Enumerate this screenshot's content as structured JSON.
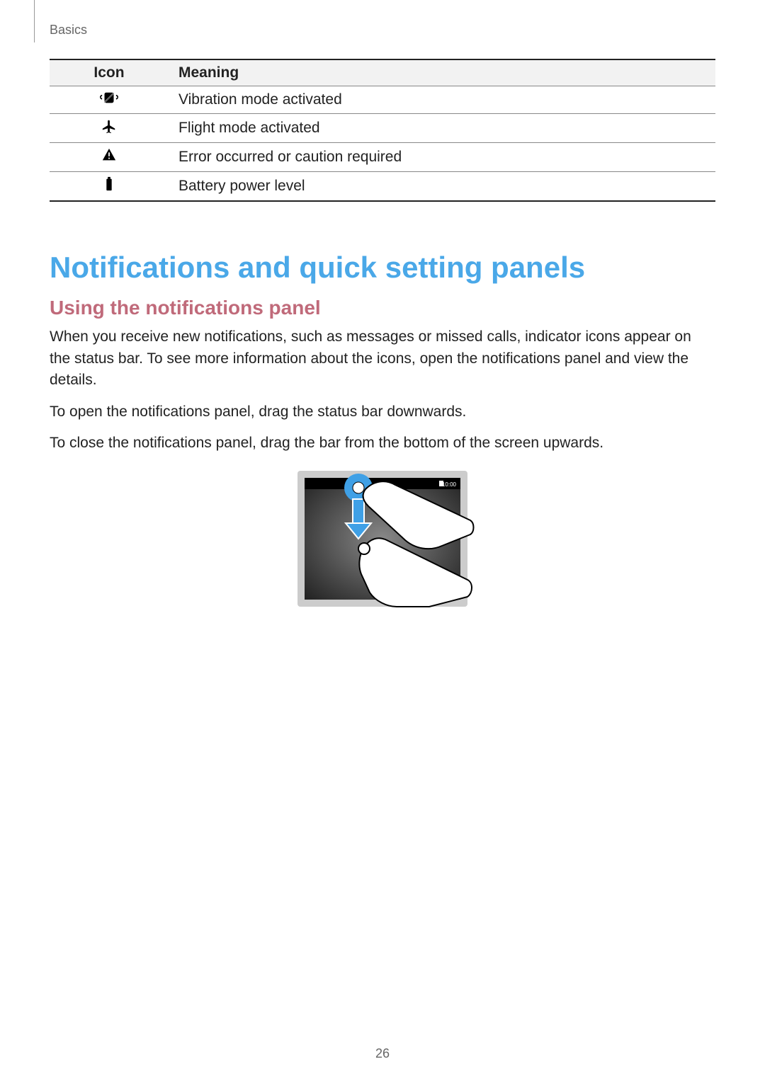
{
  "running_head": "Basics",
  "table": {
    "headers": {
      "icon": "Icon",
      "meaning": "Meaning"
    },
    "rows": [
      {
        "icon_name": "vibration-mode-icon",
        "meaning": "Vibration mode activated"
      },
      {
        "icon_name": "flight-mode-icon",
        "meaning": "Flight mode activated"
      },
      {
        "icon_name": "caution-icon",
        "meaning": "Error occurred or caution required"
      },
      {
        "icon_name": "battery-level-icon",
        "meaning": "Battery power level"
      }
    ]
  },
  "section_heading": "Notifications and quick setting panels",
  "sub_heading": "Using the notifications panel",
  "paragraphs": [
    "When you receive new notifications, such as messages or missed calls, indicator icons appear on the status bar. To see more information about the icons, open the notifications panel and view the details.",
    "To open the notifications panel, drag the status bar downwards.",
    "To close the notifications panel, drag the bar from the bottom of the screen upwards."
  ],
  "illustration": {
    "name": "drag-status-bar-down-illustration",
    "status_time": "10:00"
  },
  "page_number": "26"
}
